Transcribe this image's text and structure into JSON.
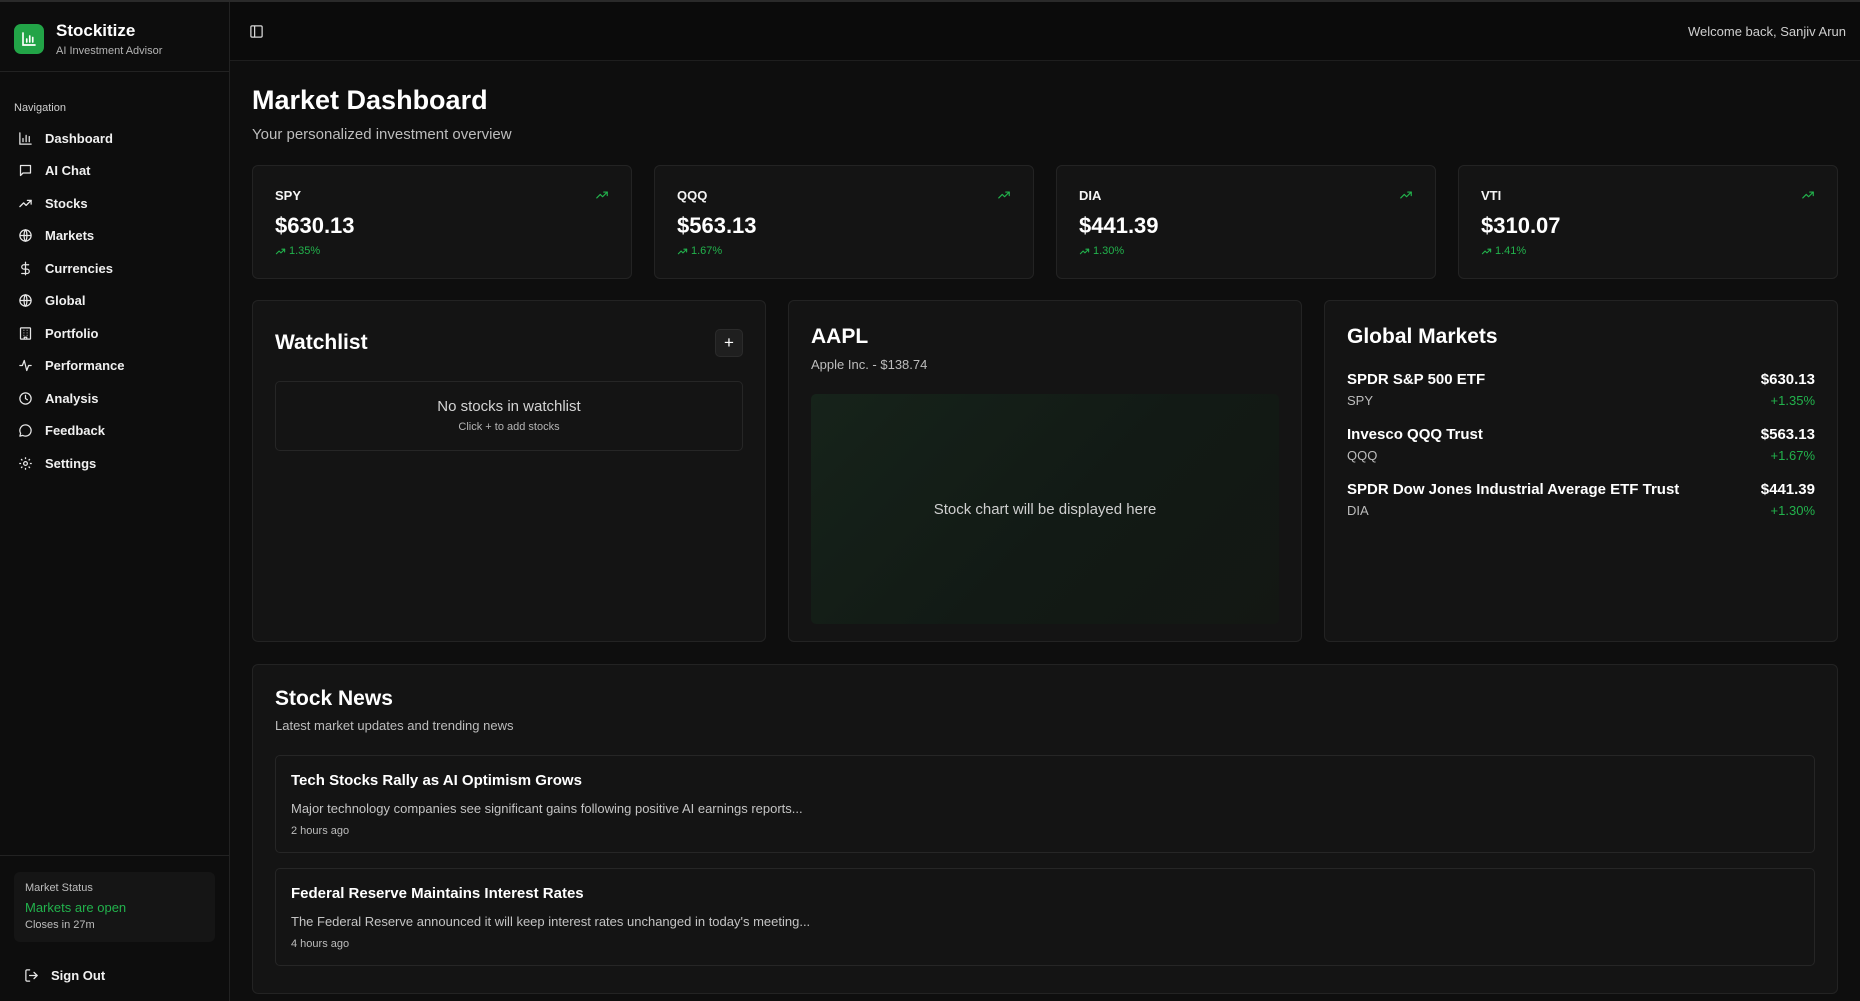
{
  "brand": {
    "name": "Stockitize",
    "subtitle": "AI Investment Advisor"
  },
  "sidebar": {
    "group_label": "Navigation",
    "items": [
      {
        "label": "Dashboard",
        "icon": "bar-chart-icon"
      },
      {
        "label": "AI Chat",
        "icon": "chat-bubble-icon"
      },
      {
        "label": "Stocks",
        "icon": "trend-up-icon"
      },
      {
        "label": "Markets",
        "icon": "globe-icon"
      },
      {
        "label": "Currencies",
        "icon": "dollar-icon"
      },
      {
        "label": "Global",
        "icon": "globe-icon"
      },
      {
        "label": "Portfolio",
        "icon": "building-icon"
      },
      {
        "label": "Performance",
        "icon": "activity-icon"
      },
      {
        "label": "Analysis",
        "icon": "clock-icon"
      },
      {
        "label": "Feedback",
        "icon": "chat-bubble-icon"
      },
      {
        "label": "Settings",
        "icon": "gear-icon"
      }
    ],
    "status": {
      "title": "Market Status",
      "state": "Markets are open",
      "closes": "Closes in 27m"
    },
    "signout_label": "Sign Out"
  },
  "header": {
    "welcome": "Welcome back, Sanjiv Arun"
  },
  "dashboard": {
    "title": "Market Dashboard",
    "subtitle": "Your personalized investment overview"
  },
  "tickers": [
    {
      "symbol": "SPY",
      "price": "$630.13",
      "change": "1.35%"
    },
    {
      "symbol": "QQQ",
      "price": "$563.13",
      "change": "1.67%"
    },
    {
      "symbol": "DIA",
      "price": "$441.39",
      "change": "1.30%"
    },
    {
      "symbol": "VTI",
      "price": "$310.07",
      "change": "1.41%"
    }
  ],
  "watchlist": {
    "title": "Watchlist",
    "add_label": "+",
    "empty_title": "No stocks in watchlist",
    "empty_hint": "Click + to add stocks"
  },
  "stock": {
    "symbol": "AAPL",
    "subtitle": "Apple Inc. - $138.74",
    "chart_placeholder": "Stock chart will be displayed here"
  },
  "global_markets": {
    "title": "Global Markets",
    "items": [
      {
        "name": "SPDR S&P 500 ETF",
        "symbol": "SPY",
        "price": "$630.13",
        "change": "+1.35%"
      },
      {
        "name": "Invesco QQQ Trust",
        "symbol": "QQQ",
        "price": "$563.13",
        "change": "+1.67%"
      },
      {
        "name": "SPDR Dow Jones Industrial Average ETF Trust",
        "symbol": "DIA",
        "price": "$441.39",
        "change": "+1.30%"
      }
    ]
  },
  "news": {
    "title": "Stock News",
    "subtitle": "Latest market updates and trending news",
    "items": [
      {
        "headline": "Tech Stocks Rally as AI Optimism Grows",
        "desc": "Major technology companies see significant gains following positive AI earnings reports...",
        "time": "2 hours ago"
      },
      {
        "headline": "Federal Reserve Maintains Interest Rates",
        "desc": "The Federal Reserve announced it will keep interest rates unchanged in today's meeting...",
        "time": "4 hours ago"
      }
    ]
  },
  "colors": {
    "accent": "#22a447",
    "positive": "#22b24c",
    "background": "#0b0b0b",
    "card": "#141414"
  }
}
